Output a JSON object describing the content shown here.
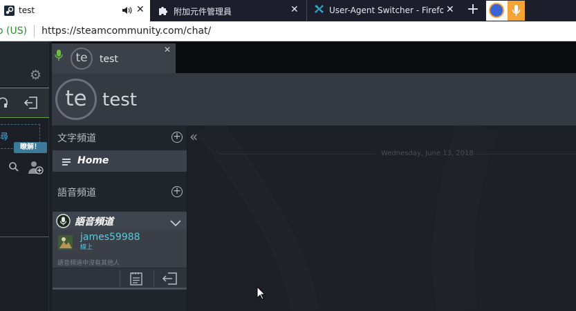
{
  "browser": {
    "tabs": [
      {
        "label": "test",
        "active": true
      },
      {
        "label": "附加元件管理員",
        "active": false
      },
      {
        "label": "User-Agent Switcher - Firefox",
        "active": false
      }
    ],
    "url_identity": "o (US)",
    "url": "https://steamcommunity.com/chat/"
  },
  "friends_panel": {
    "invite_text": "尋",
    "hint_badge": "瞭解！"
  },
  "chat": {
    "tab_title": "test",
    "tab_avatar": "te",
    "group_name": "test",
    "group_avatar": "te",
    "text_channels_title": "文字頻道",
    "home_channel": "Home",
    "voice_channels_title": "語音頻道",
    "voice_channel_name": "語音頻道",
    "voice_user_name": "james59988",
    "voice_user_status": "線上",
    "voice_empty_note": "語音頻道中沒有其他人",
    "date_divider": "Wednesday, June 13, 2018"
  },
  "colors": {
    "accent_blue": "#66c0f4",
    "voice_green": "#67a53b",
    "online_blue": "#57cbde"
  },
  "icons": [
    "steam-icon",
    "speaker-icon",
    "puzzle-icon",
    "uas-icon",
    "close-icon",
    "plus-icon",
    "gear-icon",
    "headset-icon",
    "leave-icon",
    "search-icon",
    "add-friend-icon",
    "mic-icon",
    "menu-icon",
    "collapse-icon",
    "chevron-down-icon",
    "notepad-icon",
    "cursor-icon"
  ]
}
